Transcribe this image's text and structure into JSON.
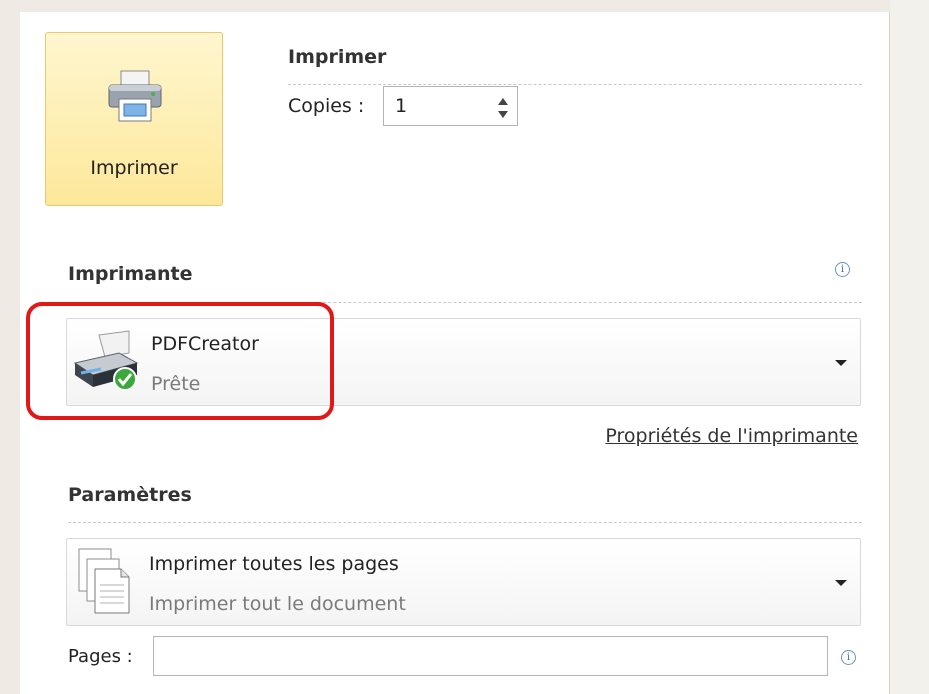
{
  "print_button": {
    "label": "Imprimer",
    "icon": "printer-icon"
  },
  "print_section": {
    "title": "Imprimer",
    "copies_label": "Copies :",
    "copies_value": "1"
  },
  "printer_section": {
    "title": "Imprimante",
    "printer_name": "PDFCreator",
    "printer_status": "Prête",
    "properties_link": "Propriétés de l'imprimante"
  },
  "settings_section": {
    "title": "Paramètres",
    "pages_option": "Imprimer toutes les pages",
    "pages_option_desc": "Imprimer tout le document",
    "pages_label": "Pages :",
    "pages_value": ""
  },
  "colors": {
    "button_bg": "#fde89a",
    "highlight": "#e01818",
    "ready_check": "#3aa83a"
  }
}
